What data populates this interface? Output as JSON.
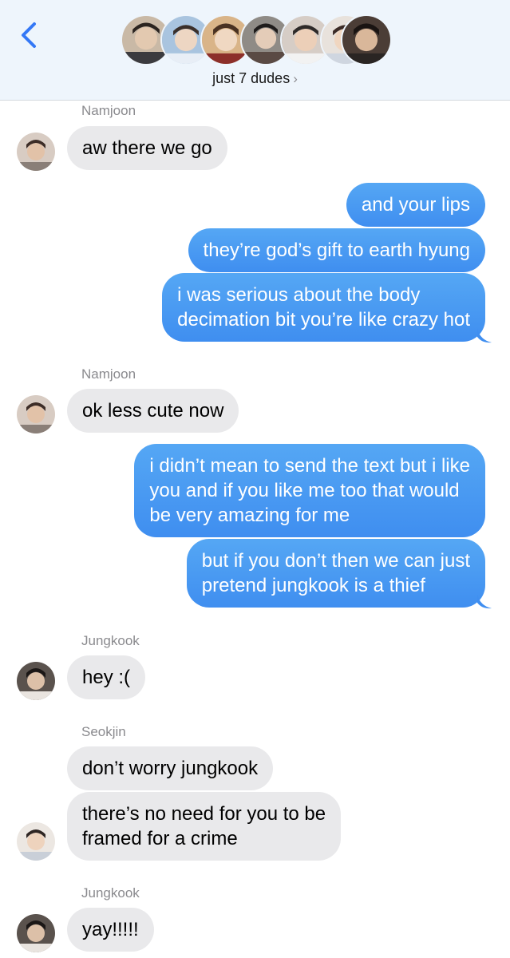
{
  "header": {
    "group_name": "just 7 dudes",
    "group_chevron": "›",
    "back_icon": "chevron-left-icon",
    "accent": "#3478f6",
    "avatar_count": 7
  },
  "messages": [
    {
      "sender": "Namjoon",
      "text": "aw there we go",
      "direction": "in"
    },
    {
      "text": "and your lips",
      "direction": "out"
    },
    {
      "text": "they’re god’s gift to earth hyung",
      "direction": "out"
    },
    {
      "text": "i was serious about the body decimation bit you’re like crazy hot",
      "lines": [
        "i was serious about the body",
        "decimation bit you’re like crazy hot"
      ],
      "direction": "out"
    },
    {
      "sender": "Namjoon",
      "text": "ok less cute now",
      "direction": "in"
    },
    {
      "text": "i didn’t mean to send the text but i like you and if you like me too that would be very amazing for me",
      "lines": [
        "i didn’t mean to send the text but i like",
        "you and if you like me too that would",
        "be very amazing for me"
      ],
      "direction": "out"
    },
    {
      "text": "but if you don’t then we can just pretend jungkook is a thief",
      "lines": [
        "but if you don’t then we can just",
        "pretend jungkook is a thief"
      ],
      "direction": "out"
    },
    {
      "sender": "Jungkook",
      "text": "hey :(",
      "direction": "in"
    },
    {
      "sender": "Seokjin",
      "text": "don’t worry jungkook",
      "direction": "in"
    },
    {
      "text": "there’s no need for you to be framed for a crime",
      "lines": [
        "there’s no need for you to be",
        "framed for a crime"
      ],
      "direction": "in"
    },
    {
      "sender": "Jungkook",
      "text": "yay!!!!!",
      "direction": "in"
    }
  ],
  "colors": {
    "incoming_bubble": "#e9e9eb",
    "outgoing_bubble": "#3f8ef0",
    "header_bg": "#eef5fc",
    "sender_label": "#8a8a8e"
  }
}
